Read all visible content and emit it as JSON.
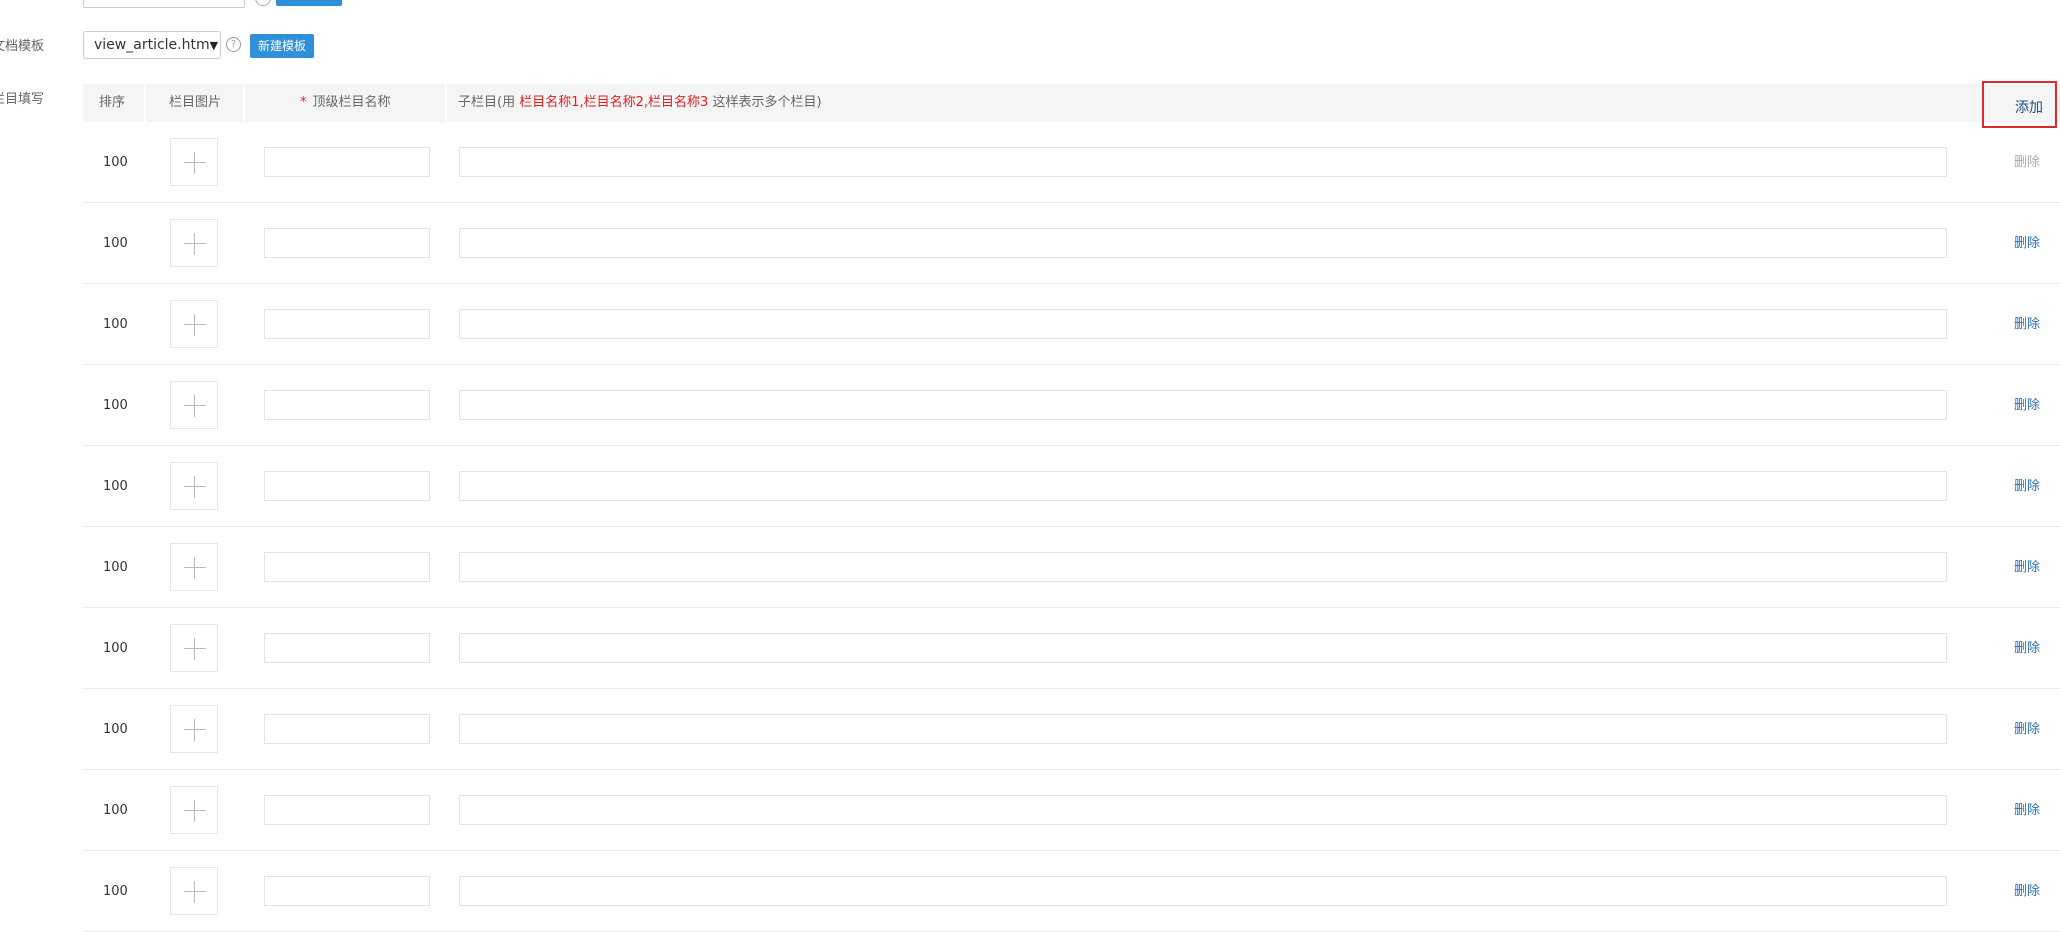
{
  "form": {
    "template_label": "文档模板",
    "columns_label": "栏目填写",
    "template_select_value": "view_article.htm",
    "new_template_button": "新建模板",
    "help_glyph": "?"
  },
  "table": {
    "headers": {
      "sort": "排序",
      "image": "栏目图片",
      "required_mark": "*",
      "top_name": "顶级栏目名称",
      "sub_prefix": "子栏目(用",
      "sub_example": "栏目名称1,栏目名称2,栏目名称3",
      "sub_suffix": "这样表示多个栏目)",
      "add": "添加"
    },
    "rows": [
      {
        "sort": "100",
        "delete": "删除"
      },
      {
        "sort": "100",
        "delete": "删除"
      },
      {
        "sort": "100",
        "delete": "删除"
      },
      {
        "sort": "100",
        "delete": "删除"
      },
      {
        "sort": "100",
        "delete": "删除"
      },
      {
        "sort": "100",
        "delete": "删除"
      },
      {
        "sort": "100",
        "delete": "删除"
      },
      {
        "sort": "100",
        "delete": "删除"
      },
      {
        "sort": "100",
        "delete": "删除"
      },
      {
        "sort": "100",
        "delete": "删除"
      }
    ]
  },
  "colors": {
    "primary_button": "#2f8fd8",
    "link": "#2a6fba",
    "required": "#e02020",
    "highlight_border": "#e02a2a"
  }
}
